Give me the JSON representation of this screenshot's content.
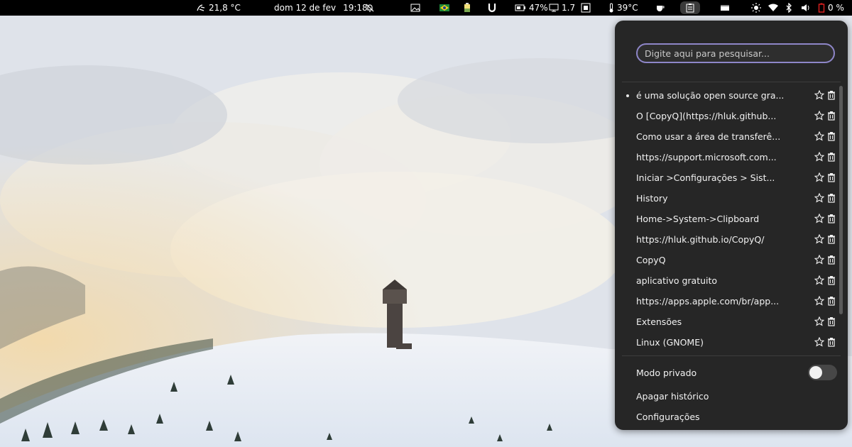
{
  "topbar": {
    "weather_temp": "21,8 °C",
    "date": "dom 12 de fev",
    "time": "19:18",
    "battery_percent": "47%",
    "load": "1.7",
    "cpu_temp": "39°C",
    "volume_percent": "0 %",
    "icons": {
      "weather": "weather-icon",
      "notifications": "bell-muted-icon",
      "screenshot": "image-icon",
      "flag": "flag-icon",
      "app": "battery-app-icon",
      "magnet": "magnet-icon",
      "battery": "battery-icon",
      "monitor": "monitor-icon",
      "memory": "memory-icon",
      "thermometer": "thermometer-icon",
      "coffee": "coffee-icon",
      "clipboard": "clipboard-icon",
      "window": "window-icon",
      "brightness": "sun-icon",
      "wifi": "wifi-icon",
      "bluetooth": "bluetooth-icon",
      "volume": "speaker-icon",
      "power": "power-battery-icon"
    }
  },
  "clipboard_menu": {
    "search_placeholder": "Digite aqui para pesquisar...",
    "items": [
      {
        "text": "é uma solução open source gra...",
        "active": true
      },
      {
        "text": "O [CopyQ](https://hluk.github...",
        "active": false
      },
      {
        "text": "Como usar a área de transferê...",
        "active": false
      },
      {
        "text": "https://support.microsoft.com...",
        "active": false
      },
      {
        "text": "Iniciar >Configurações > Sist...",
        "active": false
      },
      {
        "text": "History",
        "active": false
      },
      {
        "text": "Home->System->Clipboard",
        "active": false
      },
      {
        "text": "https://hluk.github.io/CopyQ/",
        "active": false
      },
      {
        "text": "CopyQ",
        "active": false
      },
      {
        "text": "aplicativo gratuito",
        "active": false
      },
      {
        "text": "https://apps.apple.com/br/app...",
        "active": false
      },
      {
        "text": "Extensões",
        "active": false
      },
      {
        "text": "Linux (GNOME)",
        "active": false
      }
    ],
    "private_mode_label": "Modo privado",
    "private_mode_on": false,
    "clear_history_label": "Apagar histórico",
    "settings_label": "Configurações"
  },
  "colors": {
    "topbar_bg": "#000000",
    "panel_bg": "#262626",
    "search_border": "#8e86c8",
    "battery_low": "#e02020"
  }
}
